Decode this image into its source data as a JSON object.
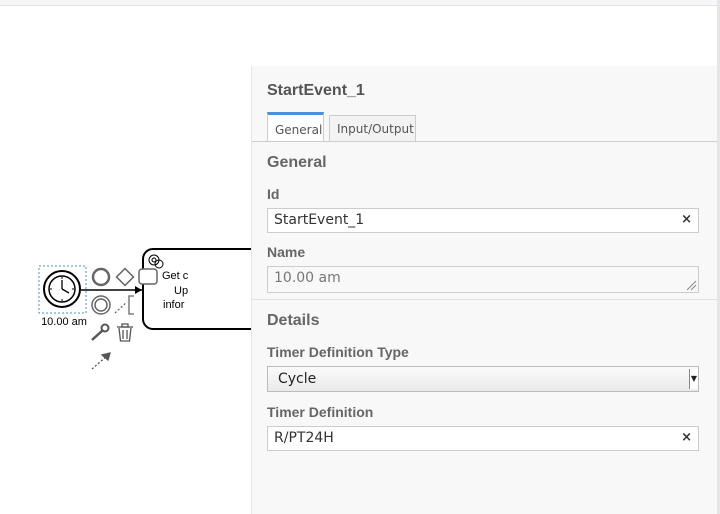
{
  "canvas": {
    "event_label": "10.00 am",
    "task_text": [
      "Get c",
      "Up",
      "infor"
    ]
  },
  "panel": {
    "title": "StartEvent_1",
    "tabs": [
      {
        "label": "General",
        "active": true
      },
      {
        "label": "Input/Output",
        "active": false
      }
    ],
    "general": {
      "title": "General",
      "id_label": "Id",
      "id_value": "StartEvent_1",
      "name_label": "Name",
      "name_value": "10.00 am"
    },
    "details": {
      "title": "Details",
      "timer_type_label": "Timer Definition Type",
      "timer_type_value": "Cycle",
      "timer_def_label": "Timer Definition",
      "timer_def_value": "R/PT24H"
    },
    "clear_symbol": "×"
  },
  "colors": {
    "active_tab_accent": "#4d90d5",
    "selection_outline": "#4a90d9"
  }
}
